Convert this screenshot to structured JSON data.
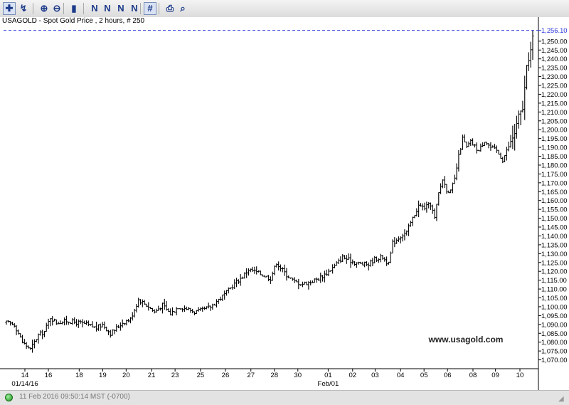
{
  "toolbar": {
    "items": [
      {
        "name": "crosshair-tool",
        "glyph": "✚",
        "selected": true
      },
      {
        "name": "draw-tool",
        "glyph": "↯"
      },
      {
        "name": "zoom-in",
        "glyph": "⊕"
      },
      {
        "name": "zoom-out",
        "glyph": "⊖"
      },
      {
        "name": "bar-chart-type",
        "glyph": "▮"
      },
      {
        "name": "study-1",
        "glyph": "N"
      },
      {
        "name": "study-2",
        "glyph": "N"
      },
      {
        "name": "study-3",
        "glyph": "N"
      },
      {
        "name": "study-4",
        "glyph": "N"
      },
      {
        "name": "grid-toggle",
        "glyph": "#",
        "selected": true
      },
      {
        "name": "print",
        "glyph": "⎙"
      },
      {
        "name": "print-preview",
        "glyph": "⌕"
      }
    ]
  },
  "chart_data": {
    "type": "ohlc",
    "title": "USAGOLD - Spot Gold Price , 2 hours, # 250",
    "watermark": "www.usagold.com",
    "current_price_label": "1,256.10",
    "current_price": 1256.1,
    "ylim": [
      1065,
      1262
    ],
    "y_ticks": [
      1070,
      1075,
      1080,
      1085,
      1090,
      1095,
      1100,
      1105,
      1110,
      1115,
      1120,
      1125,
      1130,
      1135,
      1140,
      1145,
      1150,
      1155,
      1160,
      1165,
      1170,
      1175,
      1180,
      1185,
      1190,
      1195,
      1200,
      1205,
      1210,
      1215,
      1220,
      1225,
      1230,
      1235,
      1240,
      1245,
      1250
    ],
    "x_labels": [
      {
        "label": "14",
        "pos": 0.035
      },
      {
        "label": "16",
        "pos": 0.083
      },
      {
        "label": "18",
        "pos": 0.146
      },
      {
        "label": "19",
        "pos": 0.194
      },
      {
        "label": "20",
        "pos": 0.242
      },
      {
        "label": "21",
        "pos": 0.294
      },
      {
        "label": "23",
        "pos": 0.342
      },
      {
        "label": "25",
        "pos": 0.394
      },
      {
        "label": "26",
        "pos": 0.445
      },
      {
        "label": "27",
        "pos": 0.497
      },
      {
        "label": "28",
        "pos": 0.545
      },
      {
        "label": "30",
        "pos": 0.593
      },
      {
        "label": "01",
        "pos": 0.655
      },
      {
        "label": "02",
        "pos": 0.705
      },
      {
        "label": "03",
        "pos": 0.751
      },
      {
        "label": "04",
        "pos": 0.803
      },
      {
        "label": "05",
        "pos": 0.851
      },
      {
        "label": "06",
        "pos": 0.899
      },
      {
        "label": "08",
        "pos": 0.951
      },
      {
        "label": "09",
        "pos": 0.997
      },
      {
        "label": "10",
        "pos": 1.047
      }
    ],
    "x_sublabels": [
      {
        "label": "01/14/16",
        "pos": 0.035
      },
      {
        "label": "Feb/01",
        "pos": 0.655
      }
    ],
    "series": [
      {
        "name": "Spot Gold",
        "anchors": [
          [
            0,
            1091
          ],
          [
            4,
            1090
          ],
          [
            8,
            1080
          ],
          [
            12,
            1076
          ],
          [
            16,
            1084
          ],
          [
            19,
            1086
          ],
          [
            22,
            1094
          ],
          [
            25,
            1091
          ],
          [
            30,
            1092
          ],
          [
            36,
            1091
          ],
          [
            40,
            1090
          ],
          [
            45,
            1088
          ],
          [
            48,
            1090
          ],
          [
            52,
            1085
          ],
          [
            55,
            1088
          ],
          [
            58,
            1091
          ],
          [
            62,
            1093
          ],
          [
            66,
            1104
          ],
          [
            70,
            1101
          ],
          [
            74,
            1097
          ],
          [
            78,
            1101
          ],
          [
            82,
            1096
          ],
          [
            86,
            1100
          ],
          [
            90,
            1099
          ],
          [
            94,
            1097
          ],
          [
            98,
            1098
          ],
          [
            102,
            1100
          ],
          [
            106,
            1104
          ],
          [
            110,
            1108
          ],
          [
            114,
            1113
          ],
          [
            118,
            1117
          ],
          [
            121,
            1121
          ],
          [
            124,
            1120
          ],
          [
            128,
            1118
          ],
          [
            132,
            1116
          ],
          [
            135,
            1125
          ],
          [
            137,
            1122
          ],
          [
            140,
            1118
          ],
          [
            144,
            1114
          ],
          [
            148,
            1113
          ],
          [
            152,
            1114
          ],
          [
            156,
            1116
          ],
          [
            160,
            1119
          ],
          [
            164,
            1123
          ],
          [
            168,
            1128
          ],
          [
            170,
            1127
          ],
          [
            174,
            1125
          ],
          [
            178,
            1124
          ],
          [
            181,
            1124
          ],
          [
            184,
            1127
          ],
          [
            188,
            1128
          ],
          [
            191,
            1124
          ],
          [
            193,
            1136
          ],
          [
            197,
            1140
          ],
          [
            200,
            1142
          ],
          [
            203,
            1150
          ],
          [
            206,
            1157
          ],
          [
            209,
            1156
          ],
          [
            212,
            1158
          ],
          [
            214,
            1150
          ],
          [
            216,
            1164
          ],
          [
            218,
            1172
          ],
          [
            220,
            1166
          ],
          [
            222,
            1165
          ],
          [
            224,
            1172
          ],
          [
            226,
            1185
          ],
          [
            228,
            1195
          ],
          [
            230,
            1190
          ],
          [
            232,
            1193
          ],
          [
            236,
            1188
          ],
          [
            239,
            1194
          ],
          [
            242,
            1190
          ],
          [
            245,
            1188
          ],
          [
            248,
            1183
          ],
          [
            250,
            1188
          ],
          [
            252,
            1193
          ],
          [
            254,
            1198
          ],
          [
            256,
            1208
          ],
          [
            258,
            1212
          ],
          [
            260,
            1235
          ],
          [
            262,
            1245
          ],
          [
            263,
            1252
          ]
        ]
      }
    ]
  },
  "status": {
    "date": "11 Feb 2016",
    "time": "09:50:14",
    "timezone": "MST (-0700)"
  },
  "colors": {
    "bar": "#000000",
    "price_line": "#2a36d8",
    "price_label": "#2a36d8"
  }
}
